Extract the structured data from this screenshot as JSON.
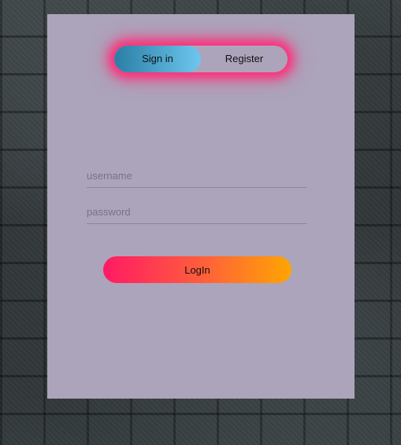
{
  "auth_toggle": {
    "sign_in_label": "Sign in",
    "register_label": "Register",
    "active_tab": "Sign in"
  },
  "form": {
    "username_placeholder": "username",
    "password_placeholder": "password",
    "username_value": "",
    "password_value": ""
  },
  "login_button": {
    "label": "LogIn"
  },
  "colors": {
    "card_background": "#aca4bb",
    "toggle_glow": "#ff2d7a",
    "toggle_active_start": "#2a7ea4",
    "toggle_active_end": "#6ec6ee",
    "login_gradient_start": "#ff1a64",
    "login_gradient_end": "#ffa502"
  }
}
